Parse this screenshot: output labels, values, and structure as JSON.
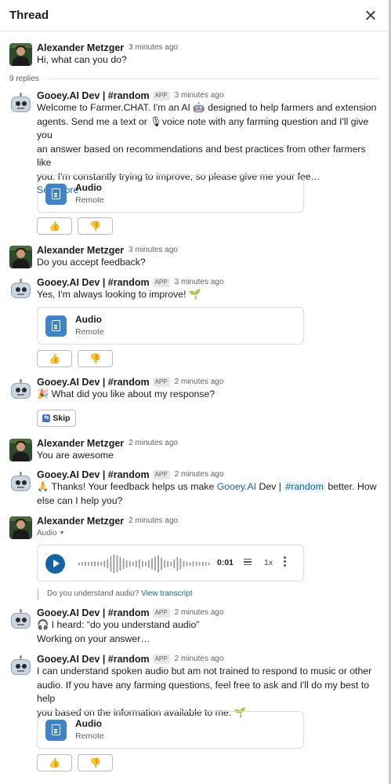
{
  "header": {
    "title": "Thread",
    "close_icon": "close-icon"
  },
  "replies_label": "9 replies",
  "messages": [
    {
      "author": "Alexander Metzger",
      "time": "3 minutes ago",
      "text": "Hi, what can you do?"
    },
    {
      "author": "Gooey.AI Dev | #random",
      "badge": "APP",
      "time": "3 minutes ago",
      "lines": [
        "Welcome to Farmer.CHAT. I'm an AI 🤖 designed to help farmers and extension",
        "agents. Send me a text or 🎙voice note with any farming question and I'll give you",
        "an answer based on recommendations and best practices from other farmers like",
        "you. I'm constantly trying to improve, so please give me your fee…"
      ],
      "see_more": "See more"
    },
    {
      "author": "Alexander Metzger",
      "time": "3 minutes ago",
      "text": "Do you accept feedback?"
    },
    {
      "author": "Gooey.AI Dev | #random",
      "badge": "APP",
      "time": "3 minutes ago",
      "text": "Yes, I'm always looking to improve! 🌱"
    },
    {
      "author": "Gooey.AI Dev | #random",
      "badge": "APP",
      "time": "2 minutes ago",
      "text": "🎉 What did you like about my response?"
    },
    {
      "author": "Alexander Metzger",
      "time": "2 minutes ago",
      "text": "You are awesome"
    },
    {
      "author": "Gooey.AI Dev | #random",
      "badge": "APP",
      "time": "2 minutes ago",
      "line1_a": "🙏 Thanks! Your feedback helps us make ",
      "line1_link": "Gooey.AI",
      "line1_b": " Dev | ",
      "line1_chan": "#random",
      "line1_c": " better. How",
      "line2": "else can I help you?"
    },
    {
      "author": "Alexander Metzger",
      "time": "2 minutes ago",
      "audio_label": "Audio"
    },
    {
      "author": "Gooey.AI Dev | #random",
      "badge": "APP",
      "time": "2 minutes ago",
      "line1": "🎧 I heard: “do you understand audio”",
      "line2": "Working on your answer…"
    },
    {
      "author": "Gooey.AI Dev | #random",
      "badge": "APP",
      "time": "2 minutes ago",
      "lines": [
        "I can understand spoken audio but am not trained to respond to music or other",
        "audio. If you have any farming questions, feel free to ask and I'll do my best to help",
        "you based on the information available to me. 🌱"
      ]
    }
  ],
  "attachment": {
    "title": "Audio",
    "subtitle": "Remote"
  },
  "feedback": {
    "up": "👍",
    "down": "👎"
  },
  "skip_label": "Skip",
  "player": {
    "duration": "0:01",
    "speed": "1x"
  },
  "transcript": {
    "prefix": "Do you understand audio? ",
    "link": "View transcript"
  }
}
